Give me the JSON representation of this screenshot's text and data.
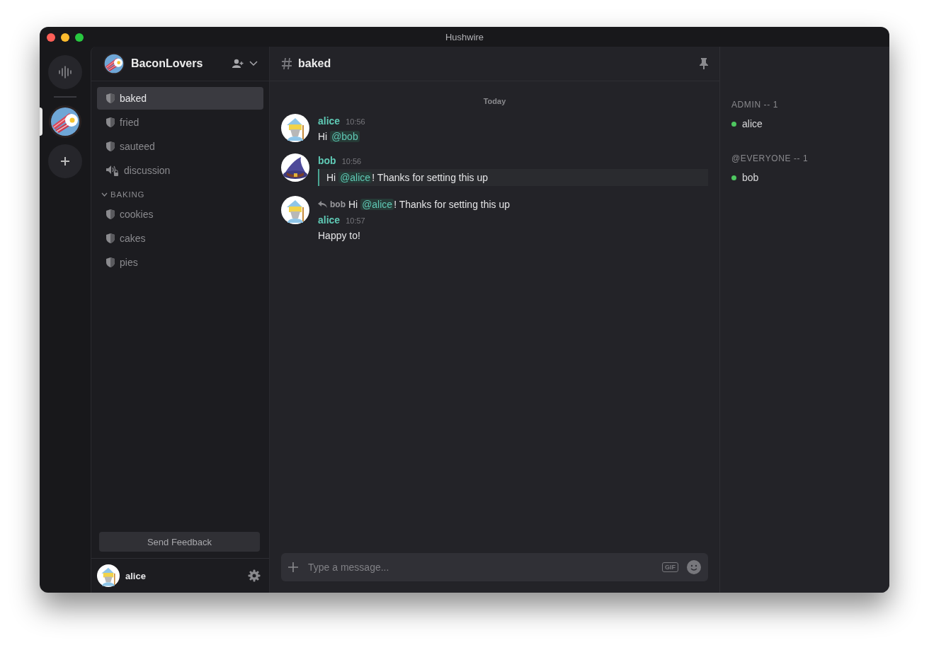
{
  "window": {
    "title": "Hushwire"
  },
  "rail": {
    "items": [
      {
        "kind": "voice",
        "selected": false
      },
      {
        "kind": "server",
        "selected": true
      },
      {
        "kind": "add",
        "selected": false
      }
    ]
  },
  "server": {
    "name": "BaconLovers"
  },
  "channels": [
    {
      "kind": "text",
      "name": "baked",
      "selected": true
    },
    {
      "kind": "text",
      "name": "fried",
      "selected": false
    },
    {
      "kind": "text",
      "name": "sauteed",
      "selected": false
    },
    {
      "kind": "voice",
      "name": "discussion",
      "selected": false
    }
  ],
  "categories": [
    {
      "name": "BAKING",
      "expanded": true,
      "channels": [
        {
          "kind": "text",
          "name": "cookies",
          "selected": false
        },
        {
          "kind": "text",
          "name": "cakes",
          "selected": false
        },
        {
          "kind": "text",
          "name": "pies",
          "selected": false
        }
      ]
    }
  ],
  "feedback_button": "Send Feedback",
  "user": {
    "name": "alice",
    "avatar": {
      "kind": "wizard"
    }
  },
  "channel_header": {
    "name": "baked"
  },
  "day_divider": "Today",
  "messages": [
    {
      "kind": "normal",
      "author": "alice",
      "avatar": {
        "kind": "wizard"
      },
      "time": "10:56",
      "parts": [
        {
          "kind": "text",
          "text": "Hi "
        },
        {
          "kind": "mention",
          "text": "@bob"
        }
      ]
    },
    {
      "kind": "quote",
      "author": "bob",
      "avatar": {
        "kind": "hat"
      },
      "time": "10:56",
      "parts": [
        {
          "kind": "text",
          "text": "Hi "
        },
        {
          "kind": "mention",
          "text": "@alice"
        },
        {
          "kind": "text",
          "text": "! Thanks for setting this up"
        }
      ]
    },
    {
      "kind": "reply",
      "author": "alice",
      "avatar": {
        "kind": "wizard"
      },
      "time": "10:57",
      "reply_to": {
        "author": "bob",
        "parts": [
          {
            "kind": "text",
            "text": "Hi "
          },
          {
            "kind": "mention",
            "text": "@alice"
          },
          {
            "kind": "text",
            "text": "! Thanks for setting this up"
          }
        ]
      },
      "parts": [
        {
          "kind": "text",
          "text": "Happy to!"
        }
      ]
    }
  ],
  "composer": {
    "placeholder": "Type a message...",
    "gif_label": "GIF"
  },
  "member_groups": [
    {
      "title": "ADMIN -- 1",
      "members": [
        {
          "name": "alice",
          "color": "#4ec760"
        }
      ]
    },
    {
      "title": "@EVERYONE -- 1",
      "members": [
        {
          "name": "bob",
          "color": "#4ec760"
        }
      ]
    }
  ]
}
